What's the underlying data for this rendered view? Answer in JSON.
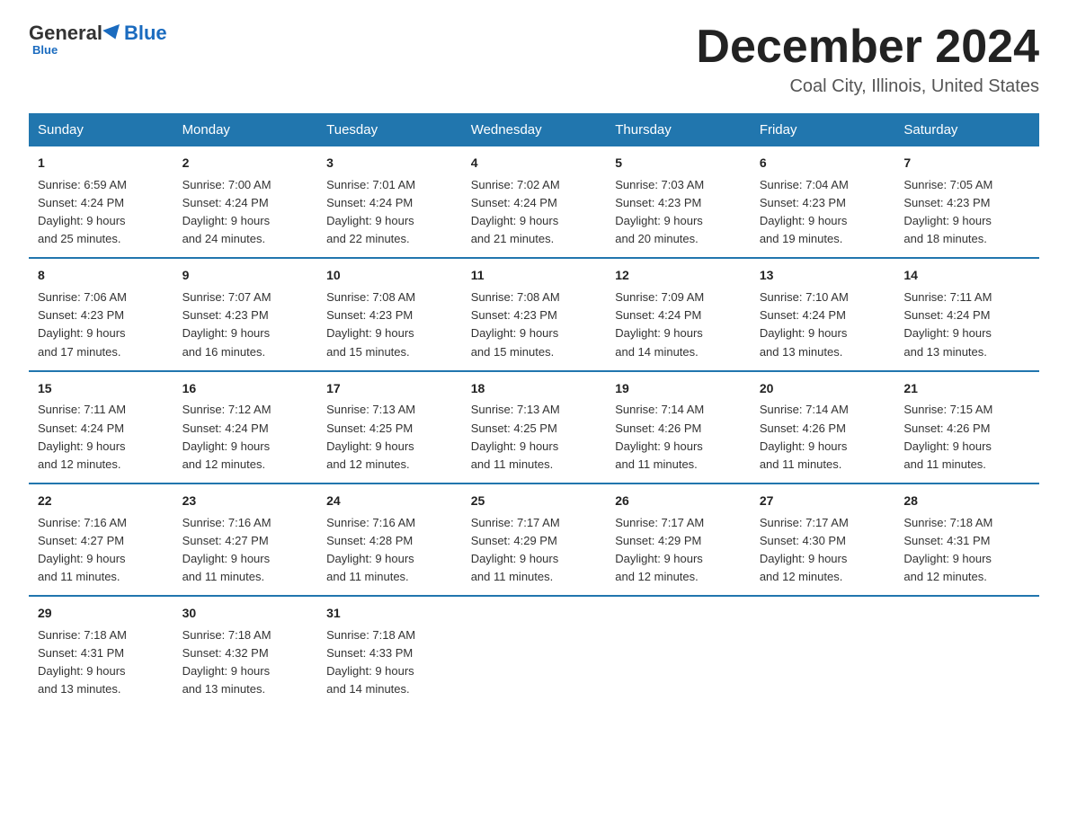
{
  "logo": {
    "general": "General",
    "triangle": "",
    "blue": "Blue",
    "underline": "Blue"
  },
  "header": {
    "month": "December 2024",
    "location": "Coal City, Illinois, United States"
  },
  "days_of_week": [
    "Sunday",
    "Monday",
    "Tuesday",
    "Wednesday",
    "Thursday",
    "Friday",
    "Saturday"
  ],
  "weeks": [
    [
      {
        "day": "1",
        "sunrise": "6:59 AM",
        "sunset": "4:24 PM",
        "daylight": "9 hours and 25 minutes."
      },
      {
        "day": "2",
        "sunrise": "7:00 AM",
        "sunset": "4:24 PM",
        "daylight": "9 hours and 24 minutes."
      },
      {
        "day": "3",
        "sunrise": "7:01 AM",
        "sunset": "4:24 PM",
        "daylight": "9 hours and 22 minutes."
      },
      {
        "day": "4",
        "sunrise": "7:02 AM",
        "sunset": "4:24 PM",
        "daylight": "9 hours and 21 minutes."
      },
      {
        "day": "5",
        "sunrise": "7:03 AM",
        "sunset": "4:23 PM",
        "daylight": "9 hours and 20 minutes."
      },
      {
        "day": "6",
        "sunrise": "7:04 AM",
        "sunset": "4:23 PM",
        "daylight": "9 hours and 19 minutes."
      },
      {
        "day": "7",
        "sunrise": "7:05 AM",
        "sunset": "4:23 PM",
        "daylight": "9 hours and 18 minutes."
      }
    ],
    [
      {
        "day": "8",
        "sunrise": "7:06 AM",
        "sunset": "4:23 PM",
        "daylight": "9 hours and 17 minutes."
      },
      {
        "day": "9",
        "sunrise": "7:07 AM",
        "sunset": "4:23 PM",
        "daylight": "9 hours and 16 minutes."
      },
      {
        "day": "10",
        "sunrise": "7:08 AM",
        "sunset": "4:23 PM",
        "daylight": "9 hours and 15 minutes."
      },
      {
        "day": "11",
        "sunrise": "7:08 AM",
        "sunset": "4:23 PM",
        "daylight": "9 hours and 15 minutes."
      },
      {
        "day": "12",
        "sunrise": "7:09 AM",
        "sunset": "4:24 PM",
        "daylight": "9 hours and 14 minutes."
      },
      {
        "day": "13",
        "sunrise": "7:10 AM",
        "sunset": "4:24 PM",
        "daylight": "9 hours and 13 minutes."
      },
      {
        "day": "14",
        "sunrise": "7:11 AM",
        "sunset": "4:24 PM",
        "daylight": "9 hours and 13 minutes."
      }
    ],
    [
      {
        "day": "15",
        "sunrise": "7:11 AM",
        "sunset": "4:24 PM",
        "daylight": "9 hours and 12 minutes."
      },
      {
        "day": "16",
        "sunrise": "7:12 AM",
        "sunset": "4:24 PM",
        "daylight": "9 hours and 12 minutes."
      },
      {
        "day": "17",
        "sunrise": "7:13 AM",
        "sunset": "4:25 PM",
        "daylight": "9 hours and 12 minutes."
      },
      {
        "day": "18",
        "sunrise": "7:13 AM",
        "sunset": "4:25 PM",
        "daylight": "9 hours and 11 minutes."
      },
      {
        "day": "19",
        "sunrise": "7:14 AM",
        "sunset": "4:26 PM",
        "daylight": "9 hours and 11 minutes."
      },
      {
        "day": "20",
        "sunrise": "7:14 AM",
        "sunset": "4:26 PM",
        "daylight": "9 hours and 11 minutes."
      },
      {
        "day": "21",
        "sunrise": "7:15 AM",
        "sunset": "4:26 PM",
        "daylight": "9 hours and 11 minutes."
      }
    ],
    [
      {
        "day": "22",
        "sunrise": "7:16 AM",
        "sunset": "4:27 PM",
        "daylight": "9 hours and 11 minutes."
      },
      {
        "day": "23",
        "sunrise": "7:16 AM",
        "sunset": "4:27 PM",
        "daylight": "9 hours and 11 minutes."
      },
      {
        "day": "24",
        "sunrise": "7:16 AM",
        "sunset": "4:28 PM",
        "daylight": "9 hours and 11 minutes."
      },
      {
        "day": "25",
        "sunrise": "7:17 AM",
        "sunset": "4:29 PM",
        "daylight": "9 hours and 11 minutes."
      },
      {
        "day": "26",
        "sunrise": "7:17 AM",
        "sunset": "4:29 PM",
        "daylight": "9 hours and 12 minutes."
      },
      {
        "day": "27",
        "sunrise": "7:17 AM",
        "sunset": "4:30 PM",
        "daylight": "9 hours and 12 minutes."
      },
      {
        "day": "28",
        "sunrise": "7:18 AM",
        "sunset": "4:31 PM",
        "daylight": "9 hours and 12 minutes."
      }
    ],
    [
      {
        "day": "29",
        "sunrise": "7:18 AM",
        "sunset": "4:31 PM",
        "daylight": "9 hours and 13 minutes."
      },
      {
        "day": "30",
        "sunrise": "7:18 AM",
        "sunset": "4:32 PM",
        "daylight": "9 hours and 13 minutes."
      },
      {
        "day": "31",
        "sunrise": "7:18 AM",
        "sunset": "4:33 PM",
        "daylight": "9 hours and 14 minutes."
      },
      null,
      null,
      null,
      null
    ]
  ],
  "labels": {
    "sunrise": "Sunrise:",
    "sunset": "Sunset:",
    "daylight": "Daylight:"
  }
}
